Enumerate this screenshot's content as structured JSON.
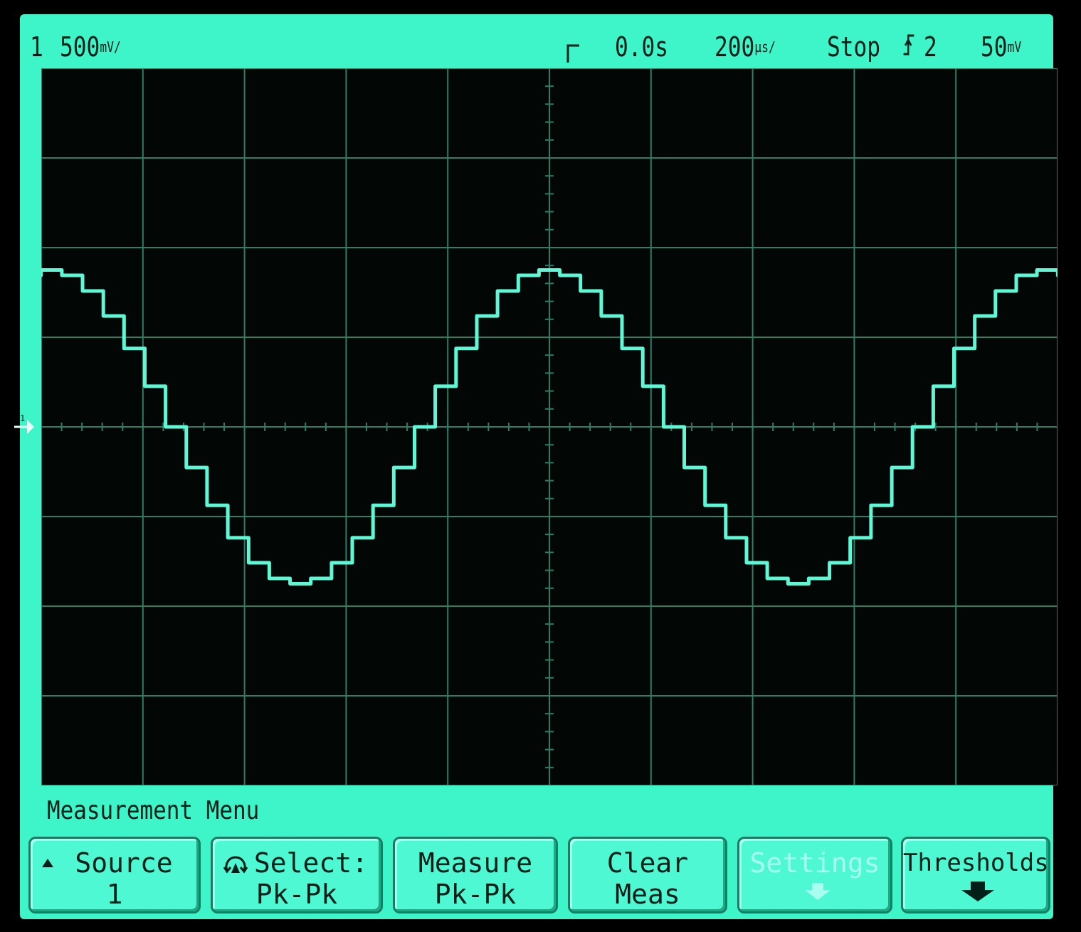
{
  "status_bar": {
    "channel": "1",
    "volts_per_div": "500",
    "volts_unit": "mV/",
    "trigger_time": "0.0s",
    "time_per_div": "200",
    "time_unit": "µs/",
    "run_state": "Stop",
    "trigger_source": "2",
    "trigger_level": "50",
    "trigger_level_unit": "mV"
  },
  "icons": {
    "trigger_edge": "rising-edge-icon",
    "trigger_marker": "trigger-position-icon",
    "ground_marker": "ground-reference-icon",
    "rotary_knob": "rotary-knob-icon",
    "up_arrow": "up-triangle-icon",
    "down_arrow": "down-arrow-icon"
  },
  "colors": {
    "screen_background": "#020604",
    "phosphor": "#3ef5c9",
    "trace": "#5ff8d6",
    "grid": "#2e7d66",
    "text": "#032018"
  },
  "menu": {
    "title": "Measurement Menu",
    "softkeys": [
      {
        "line1": "Source",
        "line2": "1"
      },
      {
        "line1": "Select:",
        "line2": "Pk-Pk"
      },
      {
        "line1": "Measure",
        "line2": "Pk-Pk"
      },
      {
        "line1": "Clear",
        "line2": "Meas"
      },
      {
        "line1": "Settings",
        "line2": "",
        "enabled": false
      },
      {
        "line1": "Thresholds",
        "line2": ""
      }
    ]
  },
  "waveform": {
    "type": "sine",
    "horizontal_divisions": 10,
    "vertical_divisions": 8,
    "period_divisions": 4.9,
    "amplitude_divisions": 1.75,
    "offset_divisions": 0.0,
    "peak_position_divisions": 5.0,
    "quantization_steps": 24
  }
}
